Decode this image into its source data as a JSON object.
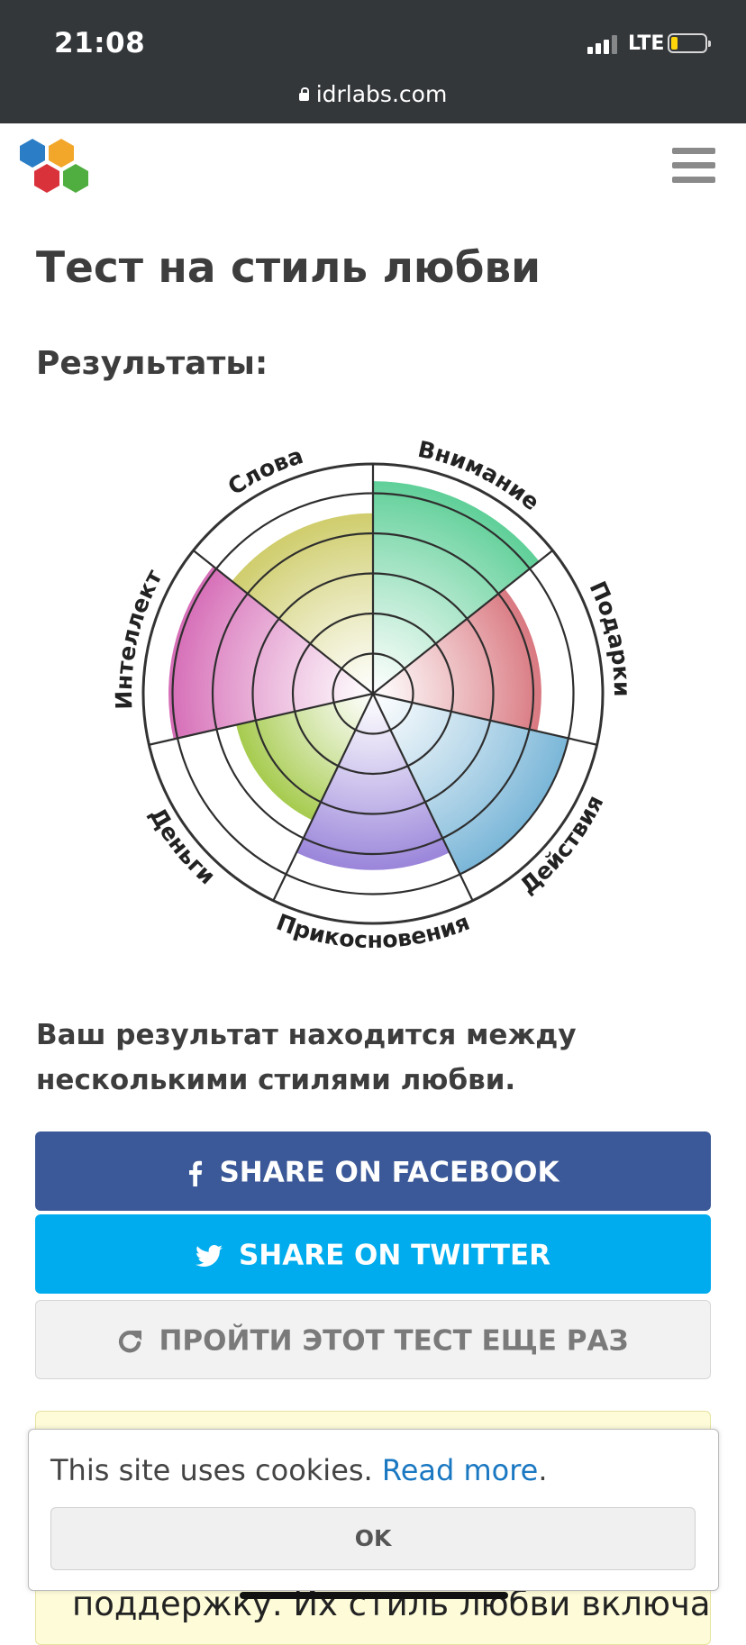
{
  "status_bar": {
    "time": "21:08",
    "network": "LTE",
    "battery_level": 0.2,
    "battery_color": "#ffd60a",
    "url": "idrlabs.com"
  },
  "header": {
    "logo_icon": "hexagon-cluster-logo",
    "logo_colors": [
      "#2b7dc5",
      "#f2a72a",
      "#d9323b",
      "#4fae3f"
    ],
    "menu_icon": "hamburger-menu-icon"
  },
  "page": {
    "title": "Тест на стиль любви",
    "results_label": "Результаты:"
  },
  "chart_data": {
    "type": "polar-area",
    "categories": [
      "Внимание",
      "Подарки",
      "Действия",
      "Прикосновения",
      "Деньги",
      "Интеллект",
      "Слова"
    ],
    "values": [
      5.3,
      4.2,
      5.0,
      4.4,
      3.5,
      5.1,
      4.5
    ],
    "max_rings": 5,
    "colors": [
      "#5fcf98",
      "#d97880",
      "#7ab6d8",
      "#9a85da",
      "#a6cb4e",
      "#d66db7",
      "#cfcd6c"
    ]
  },
  "result": {
    "text_line1": "Ваш результат находится между",
    "text_line2": "несколькими стилями любви."
  },
  "share": {
    "facebook_label": "SHARE ON FACEBOOK",
    "facebook_icon": "facebook-icon",
    "twitter_label": "SHARE ON TWITTER",
    "twitter_icon": "twitter-icon",
    "retake_label": "ПРОЙТИ ЭТОТ ТЕСТ ЕЩЕ РАЗ",
    "retake_icon": "refresh-icon"
  },
  "yellow_box": {
    "text": "поддержку. Их стиль любви включает в"
  },
  "cookie_banner": {
    "message": "This site uses cookies.",
    "link": "Read more",
    "period": ".",
    "ok_label": "OK"
  }
}
